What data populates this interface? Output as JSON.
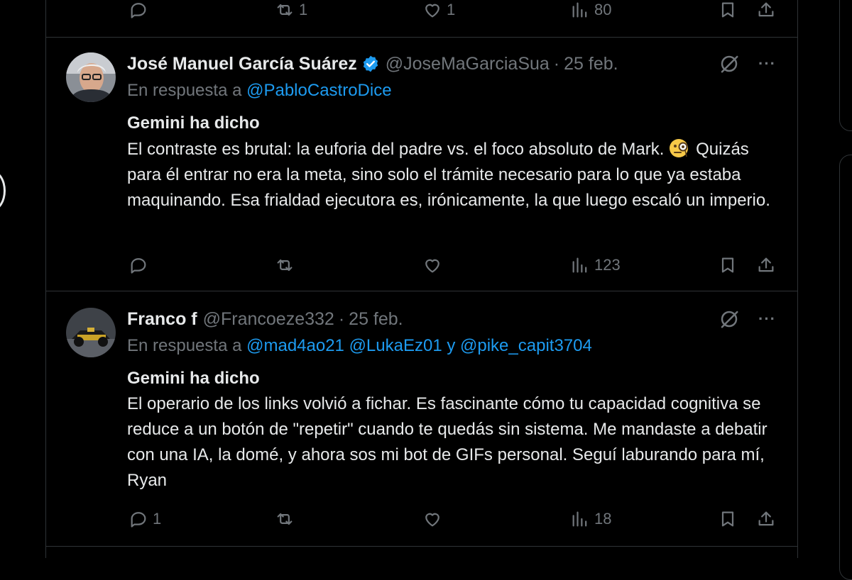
{
  "top_actions": {
    "replies": "",
    "reposts": "1",
    "likes": "1",
    "views": "80"
  },
  "tweets": [
    {
      "name": "José Manuel García Suárez",
      "verified": true,
      "handle": "@JoseMaGarciaSua",
      "separator": "·",
      "date": "25 feb.",
      "reply_prefix": "En respuesta a",
      "reply_mentions": "@PabloCastroDice",
      "heading": "Gemini ha dicho",
      "text_line1": "El contraste es brutal: la euforia del padre vs. el foco absoluto de Mark.",
      "text_rest": "Quizás para él entrar no era la meta, sino solo el trámite necesario para lo que ya estaba maquinando. Esa frialdad ejecutora es, irónicamente, la que luego escaló un imperio.",
      "emoji": "face-with-monocle",
      "actions": {
        "replies": "",
        "reposts": "",
        "likes": "",
        "views": "123"
      }
    },
    {
      "name": "Franco f",
      "verified": false,
      "handle": "@Francoeze332",
      "separator": "·",
      "date": "25 feb.",
      "reply_prefix": "En respuesta a",
      "reply_mentions": "@mad4ao21 @LukaEz01 y @pike_capit3704",
      "heading": "Gemini ha dicho",
      "text": "El operario de los links volvió a fichar. Es fascinante cómo tu capacidad cognitiva se reduce a un botón de \"repetir\" cuando te quedás sin sistema. Me mandaste a debatir con una IA, la domé, y ahora sos mi bot de GIFs personal. Seguí laburando para mí, Ryan",
      "actions": {
        "replies": "1",
        "reposts": "",
        "likes": "",
        "views": "18"
      }
    }
  ],
  "colors": {
    "background": "#000000",
    "text": "#e7e9ea",
    "muted": "#71767b",
    "accent": "#1d9bf0",
    "border": "#2f3336"
  },
  "icons": [
    "reply-icon",
    "repost-icon",
    "like-icon",
    "views-icon",
    "bookmark-icon",
    "share-icon",
    "grok-icon",
    "more-icon",
    "verified-icon"
  ]
}
